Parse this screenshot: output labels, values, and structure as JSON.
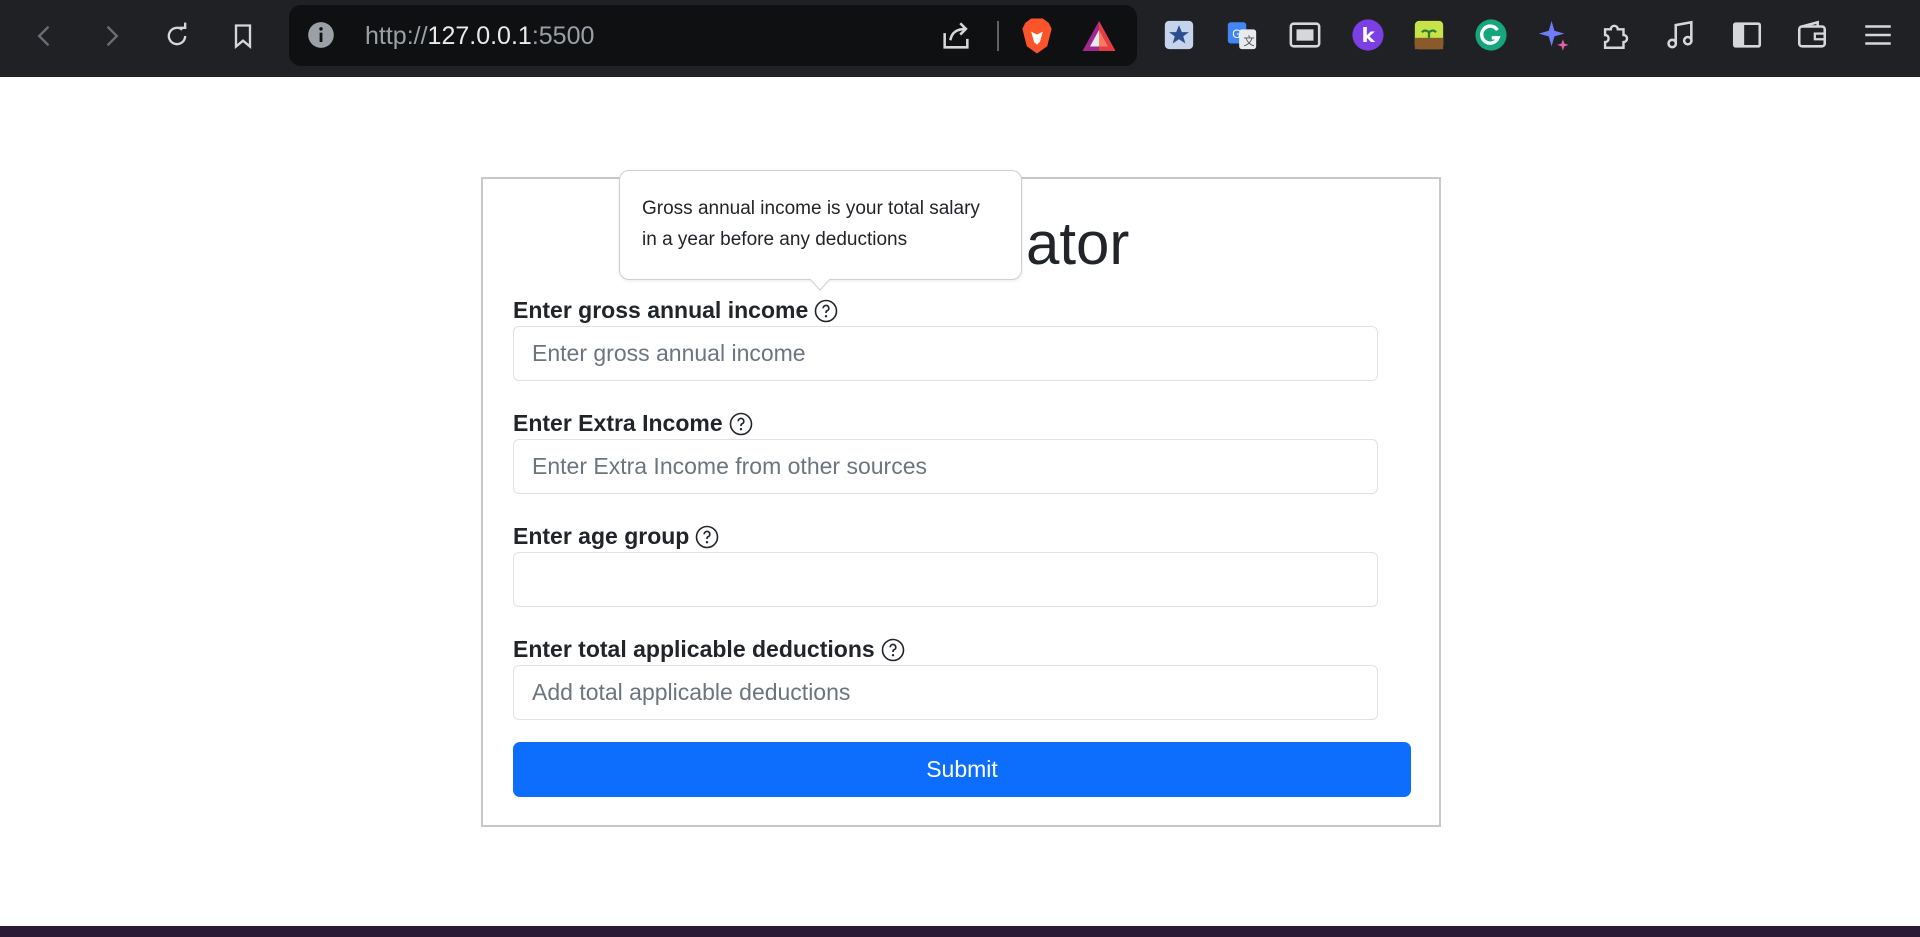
{
  "browser": {
    "url_scheme": "http://",
    "url_host": "127.0.0.1",
    "url_port": ":5500",
    "extensions": [
      "bookmark-star-icon",
      "google-translate-icon",
      "picture-in-picture-icon",
      "k-extension-icon",
      "plant-extension-icon",
      "grammarly-icon",
      "sparkle-ai-icon",
      "extensions-puzzle-icon",
      "music-note-icon",
      "sidebar-icon",
      "wallet-icon",
      "menu-icon"
    ]
  },
  "form": {
    "title_visible": "lator",
    "fields": [
      {
        "label": "Enter gross annual income",
        "placeholder": "Enter gross annual income"
      },
      {
        "label": "Enter Extra Income",
        "placeholder": "Enter Extra Income from other sources"
      },
      {
        "label": "Enter age group",
        "placeholder": ""
      },
      {
        "label": "Enter total applicable deductions",
        "placeholder": "Add total applicable deductions"
      }
    ],
    "submit_label": "Submit"
  },
  "tooltip": {
    "text": "Gross annual income is your total salary in a year before any deductions"
  },
  "colors": {
    "primary": "#0d6efd",
    "chrome_bg": "#202124",
    "urlbar_bg": "#0f1012"
  }
}
